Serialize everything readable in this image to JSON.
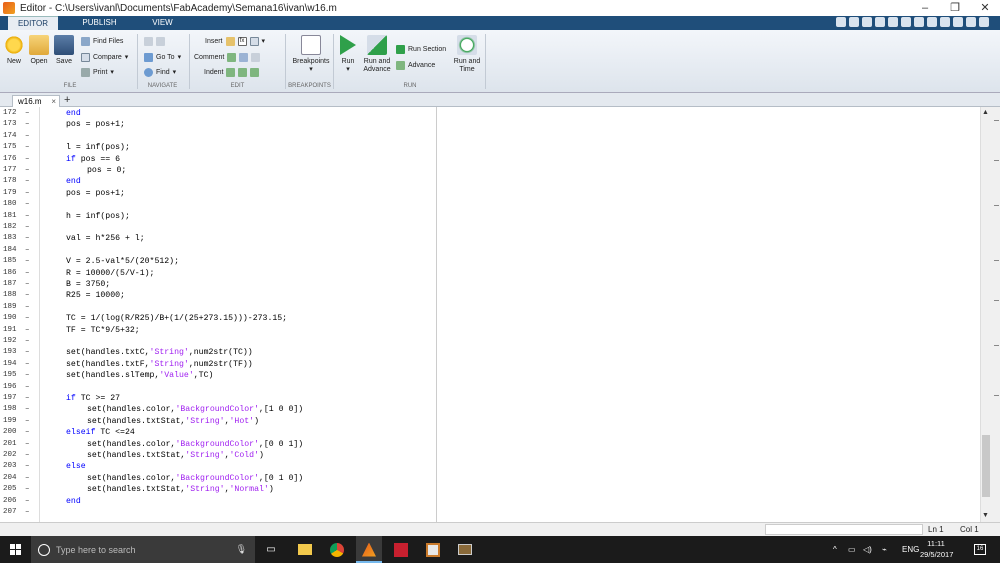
{
  "window": {
    "title": "Editor - C:\\Users\\ivanl\\Documents\\FabAcademy\\Semana16\\ivan\\w16.m",
    "minimize": "–",
    "maximize": "❐",
    "close": "✕"
  },
  "ribbon_tabs": [
    {
      "label": "EDITOR"
    },
    {
      "label": "PUBLISH"
    },
    {
      "label": "VIEW"
    }
  ],
  "ribbon": {
    "file": {
      "section": "FILE",
      "new": "New",
      "open": "Open",
      "save": "Save",
      "find_files": "Find Files",
      "compare": "Compare",
      "print": "Print"
    },
    "navigate": {
      "section": "NAVIGATE",
      "goto": "Go To",
      "find": "Find"
    },
    "edit": {
      "section": "EDIT",
      "insert": "Insert",
      "comment": "Comment",
      "indent": "Indent"
    },
    "breakpoints": {
      "section": "BREAKPOINTS",
      "label": "Breakpoints"
    },
    "run": {
      "section": "RUN",
      "run": "Run",
      "run_and_advance": "Run and Advance",
      "run_section": "Run Section",
      "advance": "Advance",
      "run_and_time": "Run and Time"
    }
  },
  "doc_tab": {
    "label": "w16.m",
    "close": "×",
    "add": "+"
  },
  "code_lines": [
    {
      "n": "172",
      "indent": 1,
      "parts": [
        [
          "kw",
          "end"
        ]
      ]
    },
    {
      "n": "173",
      "indent": 1,
      "parts": [
        [
          "t",
          "pos = pos+1;"
        ]
      ]
    },
    {
      "n": "174",
      "indent": 0,
      "parts": []
    },
    {
      "n": "175",
      "indent": 1,
      "parts": [
        [
          "t",
          "l = inf(pos);"
        ]
      ]
    },
    {
      "n": "176",
      "indent": 1,
      "parts": [
        [
          "kw",
          "if"
        ],
        [
          "t",
          " pos == 6"
        ]
      ]
    },
    {
      "n": "177",
      "indent": 2,
      "parts": [
        [
          "t",
          "pos = 0;"
        ]
      ]
    },
    {
      "n": "178",
      "indent": 1,
      "parts": [
        [
          "kw",
          "end"
        ]
      ]
    },
    {
      "n": "179",
      "indent": 1,
      "parts": [
        [
          "t",
          "pos = pos+1;"
        ]
      ]
    },
    {
      "n": "180",
      "indent": 0,
      "parts": []
    },
    {
      "n": "181",
      "indent": 1,
      "parts": [
        [
          "t",
          "h = inf(pos);"
        ]
      ]
    },
    {
      "n": "182",
      "indent": 0,
      "parts": []
    },
    {
      "n": "183",
      "indent": 1,
      "parts": [
        [
          "t",
          "val = h*256 + l;"
        ]
      ]
    },
    {
      "n": "184",
      "indent": 0,
      "parts": []
    },
    {
      "n": "185",
      "indent": 1,
      "parts": [
        [
          "t",
          "V = 2.5-val*5/(20*512);"
        ]
      ]
    },
    {
      "n": "186",
      "indent": 1,
      "parts": [
        [
          "t",
          "R = 10000/(5/V-1);"
        ]
      ]
    },
    {
      "n": "187",
      "indent": 1,
      "parts": [
        [
          "t",
          "B = 3750;"
        ]
      ]
    },
    {
      "n": "188",
      "indent": 1,
      "parts": [
        [
          "t",
          "R25 = 10000;"
        ]
      ]
    },
    {
      "n": "189",
      "indent": 0,
      "parts": []
    },
    {
      "n": "190",
      "indent": 1,
      "parts": [
        [
          "t",
          "TC = 1/(log(R/R25)/B+(1/(25+273.15)))-273.15;"
        ]
      ]
    },
    {
      "n": "191",
      "indent": 1,
      "parts": [
        [
          "t",
          "TF = TC*9/5+32;"
        ]
      ]
    },
    {
      "n": "192",
      "indent": 0,
      "parts": []
    },
    {
      "n": "193",
      "indent": 1,
      "parts": [
        [
          "t",
          "set(handles.txtC,"
        ],
        [
          "str",
          "'String'"
        ],
        [
          "t",
          ",num2str(TC))"
        ]
      ]
    },
    {
      "n": "194",
      "indent": 1,
      "parts": [
        [
          "t",
          "set(handles.txtF,"
        ],
        [
          "str",
          "'String'"
        ],
        [
          "t",
          ",num2str(TF))"
        ]
      ]
    },
    {
      "n": "195",
      "indent": 1,
      "parts": [
        [
          "t",
          "set(handles.slTemp,"
        ],
        [
          "str",
          "'Value'"
        ],
        [
          "t",
          ",TC)"
        ]
      ]
    },
    {
      "n": "196",
      "indent": 0,
      "parts": []
    },
    {
      "n": "197",
      "indent": 1,
      "parts": [
        [
          "kw",
          "if"
        ],
        [
          "t",
          " TC >= 27"
        ]
      ]
    },
    {
      "n": "198",
      "indent": 2,
      "parts": [
        [
          "t",
          "set(handles.color,"
        ],
        [
          "str",
          "'BackgroundColor'"
        ],
        [
          "t",
          ",[1 0 0])"
        ]
      ]
    },
    {
      "n": "199",
      "indent": 2,
      "parts": [
        [
          "t",
          "set(handles.txtStat,"
        ],
        [
          "str",
          "'String'"
        ],
        [
          "t",
          ","
        ],
        [
          "str",
          "'Hot'"
        ],
        [
          "t",
          ")"
        ]
      ]
    },
    {
      "n": "200",
      "indent": 1,
      "parts": [
        [
          "kw",
          "elseif"
        ],
        [
          "t",
          " TC <=24"
        ]
      ]
    },
    {
      "n": "201",
      "indent": 2,
      "parts": [
        [
          "t",
          "set(handles.color,"
        ],
        [
          "str",
          "'BackgroundColor'"
        ],
        [
          "t",
          ",[0 0 1])"
        ]
      ]
    },
    {
      "n": "202",
      "indent": 2,
      "parts": [
        [
          "t",
          "set(handles.txtStat,"
        ],
        [
          "str",
          "'String'"
        ],
        [
          "t",
          ","
        ],
        [
          "str",
          "'Cold'"
        ],
        [
          "t",
          ")"
        ]
      ]
    },
    {
      "n": "203",
      "indent": 1,
      "parts": [
        [
          "kw",
          "else"
        ]
      ]
    },
    {
      "n": "204",
      "indent": 2,
      "parts": [
        [
          "t",
          "set(handles.color,"
        ],
        [
          "str",
          "'BackgroundColor'"
        ],
        [
          "t",
          ",[0 1 0])"
        ]
      ]
    },
    {
      "n": "205",
      "indent": 2,
      "parts": [
        [
          "t",
          "set(handles.txtStat,"
        ],
        [
          "str",
          "'String'"
        ],
        [
          "t",
          ","
        ],
        [
          "str",
          "'Normal'"
        ],
        [
          "t",
          ")"
        ]
      ]
    },
    {
      "n": "206",
      "indent": 1,
      "parts": [
        [
          "kw",
          "end"
        ]
      ]
    },
    {
      "n": "207",
      "indent": 0,
      "parts": []
    }
  ],
  "status": {
    "ln": "Ln  1",
    "col": "Col  1"
  },
  "taskbar": {
    "search_placeholder": "Type here to search",
    "lang": "ENG",
    "time": "11:11",
    "date": "29/5/2017",
    "notifications": "16"
  },
  "colors": {
    "keyword": "#0000ff",
    "string": "#a020f0",
    "ribbon_tab_bg": "#1f4e7a",
    "taskbar": "#1b1b1b"
  }
}
